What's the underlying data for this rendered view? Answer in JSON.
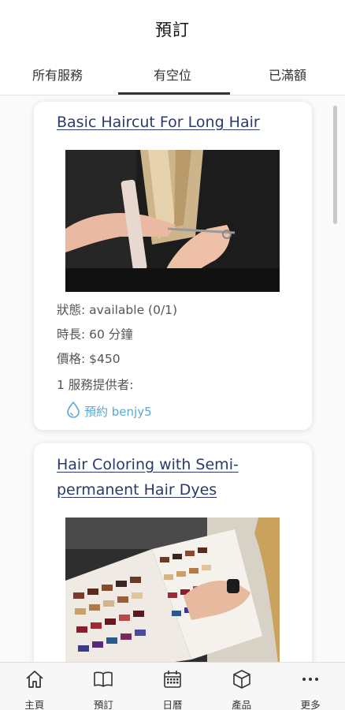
{
  "header": {
    "title": "預訂"
  },
  "tabs": [
    {
      "label": "所有服務",
      "active": false
    },
    {
      "label": "有空位",
      "active": true
    },
    {
      "label": "已滿額",
      "active": false
    }
  ],
  "services": [
    {
      "title": "Basic Haircut For Long Hair",
      "image": "haircut-photo",
      "status": "狀態: available (0/1)",
      "duration": "時長: 60 分鐘",
      "price": "價格: $450",
      "providers": "1 服務提供者:",
      "book_label": "預約 benjy5",
      "book_icon": "drop-icon"
    },
    {
      "title": "Hair Coloring with Semi-permanent Hair Dyes",
      "image": "hair-color-swatch-photo"
    }
  ],
  "bottom_nav": [
    {
      "label": "主頁",
      "icon": "home-icon"
    },
    {
      "label": "預訂",
      "icon": "book-icon"
    },
    {
      "label": "日曆",
      "icon": "calendar-icon"
    },
    {
      "label": "產品",
      "icon": "box-icon"
    },
    {
      "label": "更多",
      "icon": "more-icon"
    }
  ],
  "colors": {
    "link": "#2a3a6e",
    "accent": "#5aa8d6",
    "text": "#555555"
  }
}
